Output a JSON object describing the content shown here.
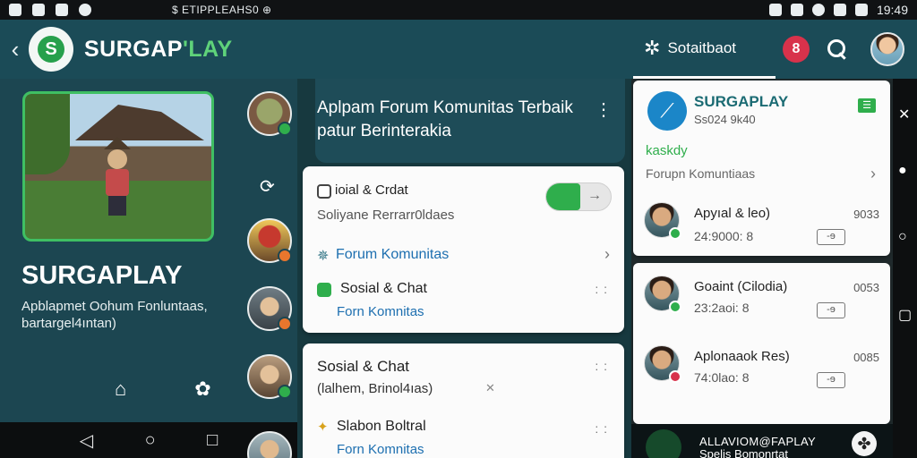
{
  "statusbar": {
    "carrier": "$ ETIPPLEAHS0 ⊕",
    "time": "19:49"
  },
  "appbar": {
    "back_icon": "chevron-left-icon",
    "brand_prefix": "SURGAP",
    "brand_suffix": "'LAY",
    "sort_label": "Sotaitbaot"
  },
  "left": {
    "title": "SURGAPLAY",
    "subtitle": "Apblapmet Oohum Fonluntaas, bartargel4ıntan)"
  },
  "middle": {
    "banner": "Aplpam Forum Komunitas Terbaik patur Berinterakia",
    "card1": {
      "row1_title": "ioial & Crdat",
      "row1_sub": "Soliyane Rerrarr0ldaes",
      "forum_label": "Forum Komunitas",
      "row3_title": "Sosial & Chat",
      "row3_sub": "Forn Komnitas"
    },
    "card2": {
      "title": "Sosial & Chat",
      "sub": "(lalhem, Brinol4ıas)",
      "x_mark": "✕",
      "row2_title": "Slabon Boltral",
      "row2_sub": "Forn Komnitas"
    }
  },
  "right": {
    "card_title": "SURGAPLAY",
    "card_sub": "Ss024 9k40",
    "section_label": "kaskdy",
    "section_sub": "Forupn Komuntiaas",
    "badge": "☰",
    "users": [
      {
        "name": "Apyıal & leo)",
        "time": "24:9000: 8",
        "count": "9033",
        "reply": "-ɘ"
      },
      {
        "name": "Goaint (Cilodia)",
        "time": "23:2aoi: 8",
        "count": "0053",
        "reply": "-ɘ"
      },
      {
        "name": "Aplonaaok Res)",
        "time": "74:0lao: 8",
        "count": "0085",
        "reply": "-ɘ"
      }
    ]
  },
  "bottom_promo": {
    "line1": "ALLAVIOM@FAPLAY",
    "line2": "Spelis Bomonrtat"
  }
}
